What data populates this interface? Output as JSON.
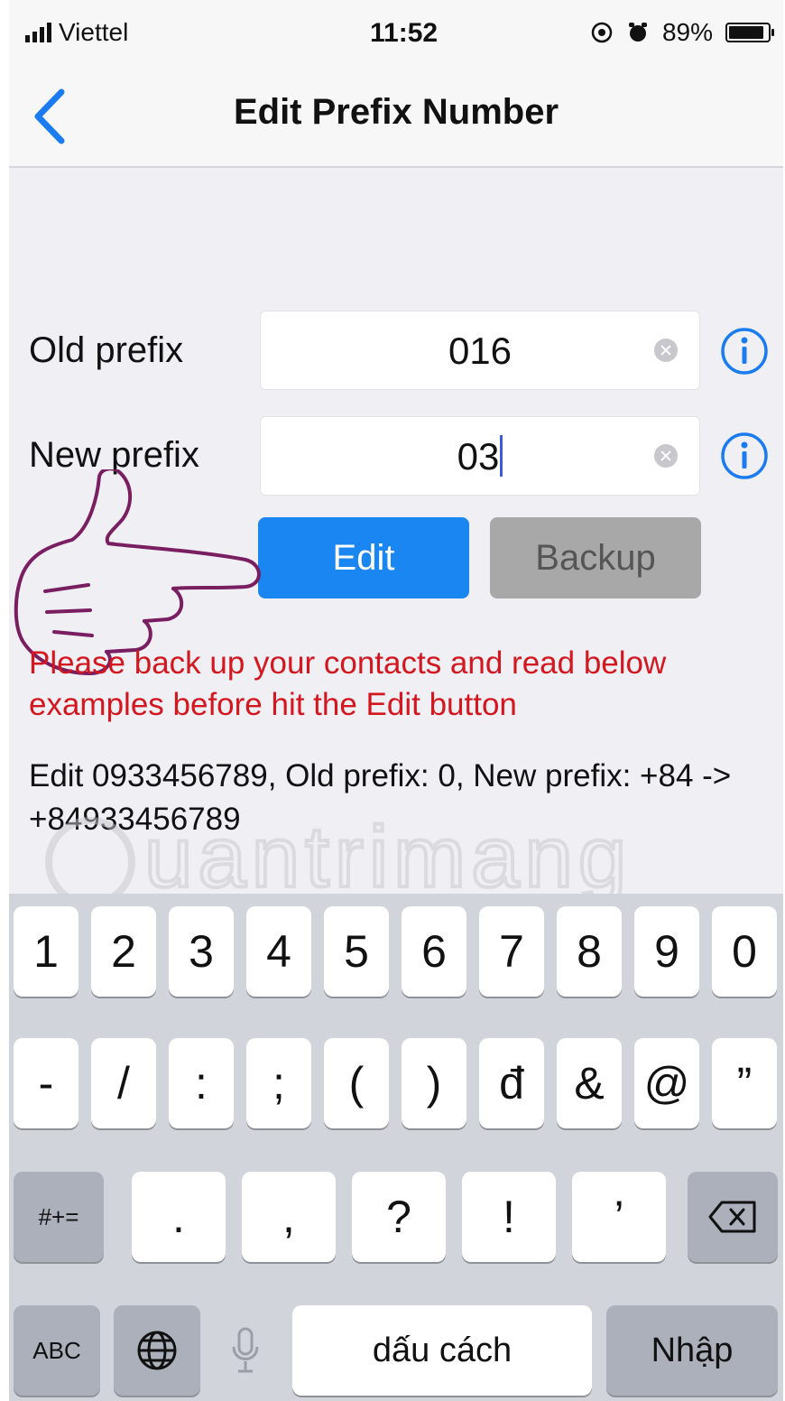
{
  "status_bar": {
    "carrier": "Viettel",
    "time": "11:52",
    "battery": "89%"
  },
  "nav": {
    "title": "Edit Prefix Number"
  },
  "form": {
    "old_label": "Old prefix",
    "old_value": "016",
    "new_label": "New prefix",
    "new_value": "03",
    "edit_label": "Edit",
    "backup_label": "Backup"
  },
  "warning": "Please back up your contacts and read below examples before hit the Edit button",
  "example": "Edit 0933456789, Old prefix: 0, New prefix: +84 -> +84933456789",
  "watermark": "Quantrimang",
  "keyboard": {
    "row1": [
      "1",
      "2",
      "3",
      "4",
      "5",
      "6",
      "7",
      "8",
      "9",
      "0"
    ],
    "row2": [
      "-",
      "/",
      ":",
      ";",
      "(",
      ")",
      "đ",
      "&",
      "@",
      "”"
    ],
    "row3_mode": "#+=",
    "row3": [
      ".",
      ",",
      "?",
      "!",
      "’"
    ],
    "abc": "ABC",
    "space": "dấu cách",
    "return": "Nhập"
  }
}
